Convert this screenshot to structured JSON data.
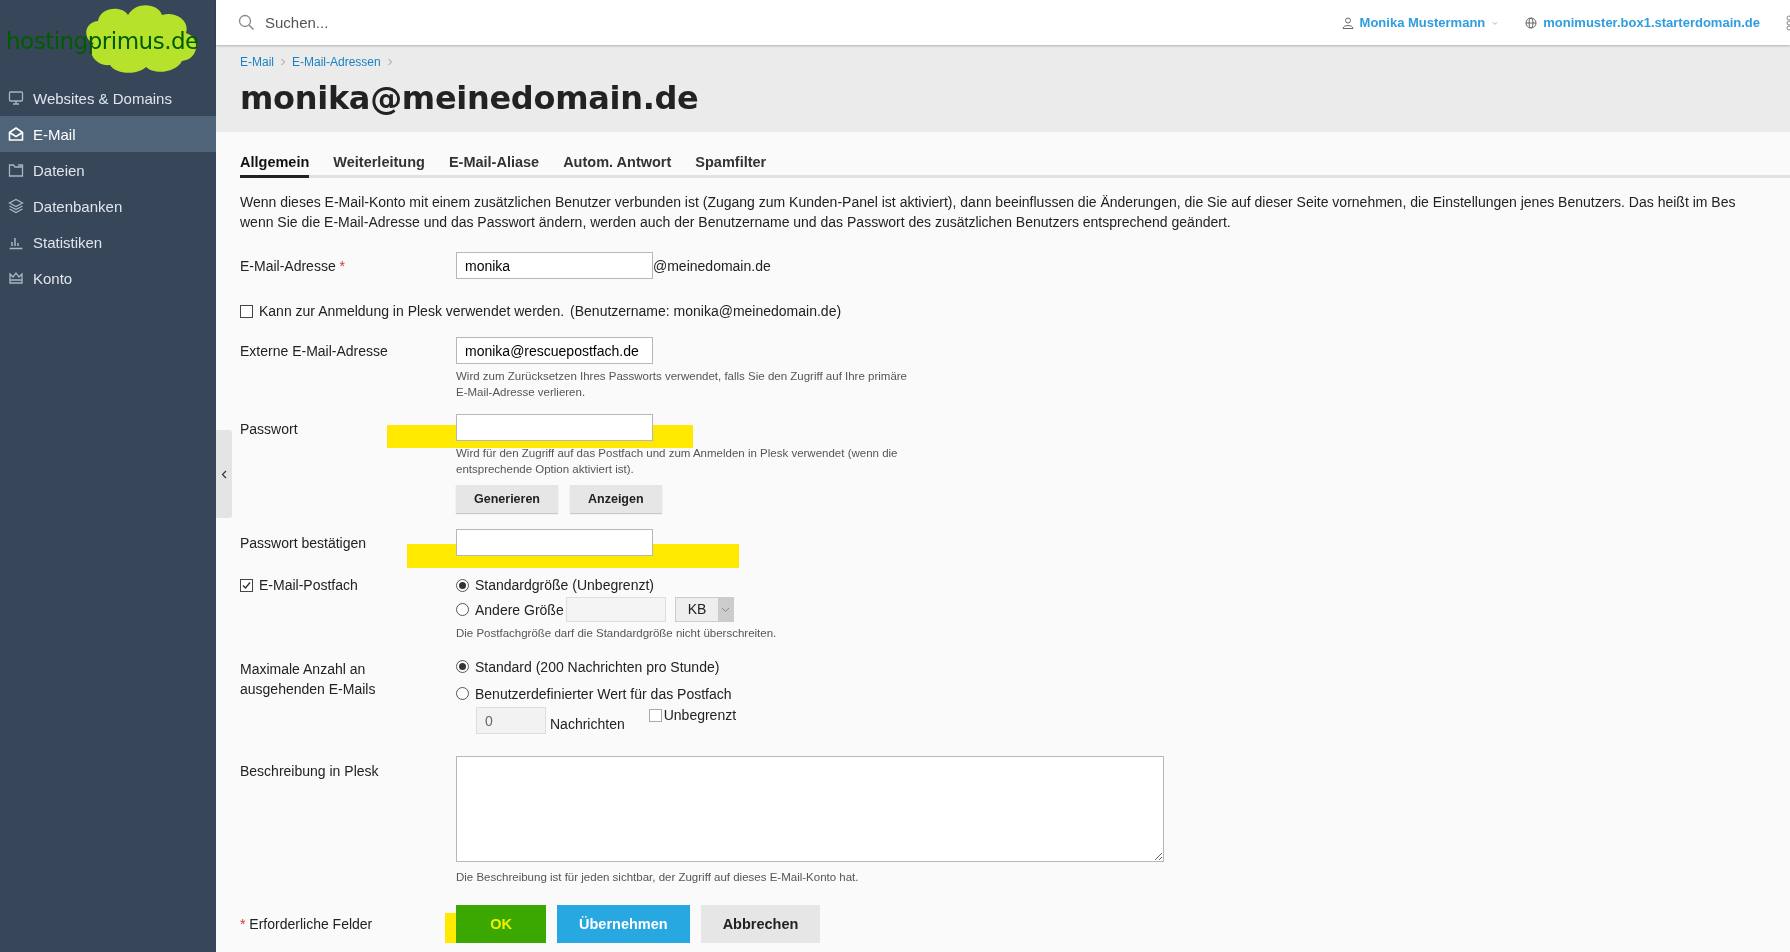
{
  "logo": {
    "text": "hostingprimus.de"
  },
  "sidebar": {
    "items": [
      {
        "label": "Websites & Domains",
        "selected": false
      },
      {
        "label": "E-Mail",
        "selected": true
      },
      {
        "label": "Dateien",
        "selected": false
      },
      {
        "label": "Datenbanken",
        "selected": false
      },
      {
        "label": "Statistiken",
        "selected": false
      },
      {
        "label": "Konto",
        "selected": false
      }
    ]
  },
  "topbar": {
    "search": {
      "placeholder": "Suchen..."
    },
    "user": "Monika Mustermann",
    "domain": "monimuster.box1.starterdomain.de"
  },
  "breadcrumbs": [
    "E-Mail",
    "E-Mail-Adressen"
  ],
  "title": "monika@meinedomain.de",
  "tabs": [
    {
      "label": "Allgemein",
      "selected": true
    },
    {
      "label": "Weiterleitung",
      "selected": false
    },
    {
      "label": "E-Mail-Aliase",
      "selected": false
    },
    {
      "label": "Autom. Antwort",
      "selected": false
    },
    {
      "label": "Spamfilter",
      "selected": false
    }
  ],
  "notice": "Wenn dieses E-Mail-Konto mit einem zusätzlichen Benutzer verbunden ist (Zugang zum Kunden-Panel ist aktiviert), dann beeinflussen die Änderungen, die Sie auf dieser Seite vornehmen, die Einstellungen jenes Benutzers. Das heißt im Bes\nwenn Sie die E-Mail-Adresse und das Passwort ändern, werden auch der Benutzername und das Passwort des zusätzlichen Benutzers entsprechend geändert.",
  "form": {
    "email_address": {
      "label": "E-Mail-Adresse",
      "required_mark": "*",
      "value": "monika",
      "suffix": "@meinedomain.de"
    },
    "plesk_login": {
      "label": "Kann zur Anmeldung in Plesk verwendet werden.",
      "note": "(Benutzername: monika@meinedomain.de)",
      "checked": false
    },
    "external_email": {
      "label": "Externe E-Mail-Adresse",
      "value": "monika@rescuepostfach.de",
      "hint": "Wird zum Zurücksetzen Ihres Passworts verwendet, falls Sie den Zugriff auf Ihre primäre\nE-Mail-Adresse verlieren."
    },
    "password": {
      "label": "Passwort",
      "hint": "Wird für den Zugriff auf das Postfach und zum Anmelden in Plesk verwendet (wenn die\nentsprechende Option aktiviert ist).",
      "buttons": [
        "Generieren",
        "Anzeigen"
      ]
    },
    "password_confirm": {
      "label": "Passwort bestätigen"
    },
    "mailbox": {
      "label": "E-Mail-Postfach",
      "checked": true,
      "options": [
        {
          "label": "Standardgröße (Unbegrenzt)",
          "selected": true
        },
        {
          "label": "Andere Größe",
          "selected": false
        }
      ],
      "unit": "KB",
      "hint": "Die Postfachgröße darf die Standardgröße nicht überschreiten."
    },
    "outgoing_limit": {
      "label": "Maximale Anzahl an\nausgehenden E-Mails",
      "options": [
        {
          "label": "Standard (200 Nachrichten pro Stunde)",
          "selected": true
        },
        {
          "label": "Benutzerdefinierter Wert für das Postfach",
          "selected": false
        }
      ],
      "value": "0",
      "unit": "Nachrichten",
      "unlimited": {
        "label": "Unbegrenzt",
        "checked": false
      }
    },
    "description": {
      "label": "Beschreibung in Plesk",
      "hint": "Die Beschreibung ist für jeden sichtbar, der Zugriff auf dieses E-Mail-Konto hat."
    },
    "required_note": {
      "mark": "*",
      "label": "Erforderliche Felder"
    },
    "buttons": [
      {
        "label": "OK",
        "kind": "highlighted"
      },
      {
        "label": "Übernehmen",
        "kind": "primary"
      },
      {
        "label": "Abbrechen",
        "kind": "secondary"
      }
    ]
  }
}
